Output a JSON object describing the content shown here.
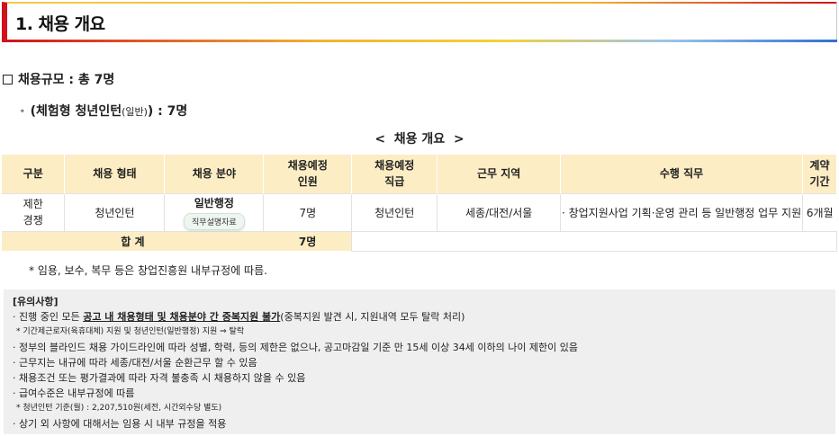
{
  "header": {
    "title": "1. 채용 개요"
  },
  "scale": {
    "label": "채용규모 : 총 7명"
  },
  "sub": {
    "bullet": "∘",
    "prefix": "(체험형 청년인턴",
    "small": "(일반)",
    "suffix": ") : 7명"
  },
  "caption": "<  채용 개요  >",
  "table": {
    "headers": [
      "구분",
      "채용 형태",
      "채용 분야",
      "채용예정\n인원",
      "채용예정\n직급",
      "근무 지역",
      "수행 직무",
      "계약\n기간"
    ],
    "row": {
      "category": "제한\n경쟁",
      "type": "청년인턴",
      "field": "일반행정",
      "field_button": "직무설명자료",
      "count": "7명",
      "grade": "청년인턴",
      "region": "세종/대전/서울",
      "duty": "· 창업지원사업 기획·운영 관리 등 일반행정 업무 지원",
      "period": "6개월"
    },
    "total": {
      "label": "합 계",
      "count": "7명"
    }
  },
  "note": "* 임용, 보수, 복무 등은 창업진흥원 내부규정에 따름.",
  "caution": {
    "title": "[유의사항]",
    "l1_pre": "· 진행 중인 모든 ",
    "l1_u": "공고 내 채용형태 및 채용분야 간 중복지원 불가",
    "l1_post": "(중복지원 발견 시, 지원내역 모두 탈락 처리)",
    "l2": "* 기간제근로자(육휴대체) 지원 및 청년인턴(일반행정) 지원 ⇒ 탈락",
    "l3": "· 정부의 블라인드 채용 가이드라인에 따라 성별, 학력, 등의 제한은 없으나, 공고마감일 기준 만 15세 이상 34세 이하의 나이 제한이 있음",
    "l4": "· 근무지는 내규에 따라 세종/대전/서울 순환근무 할 수 있음",
    "l5": "· 채용조건 또는 평가결과에 따라 자격 불충족 시 채용하지 않을 수 있음",
    "l6": "· 급여수준은 내부규정에 따름",
    "l7": "* 청년인턴 기준(월) : 2,207,510원(세전, 시간외수당 별도)",
    "l8": "· 상기 외 사항에 대해서는 임용 시 내부 규정을 적용"
  },
  "colors": {
    "accent_red": "#d0121b",
    "header_fill": "#fdedc5",
    "caution_bg": "#efefef"
  }
}
